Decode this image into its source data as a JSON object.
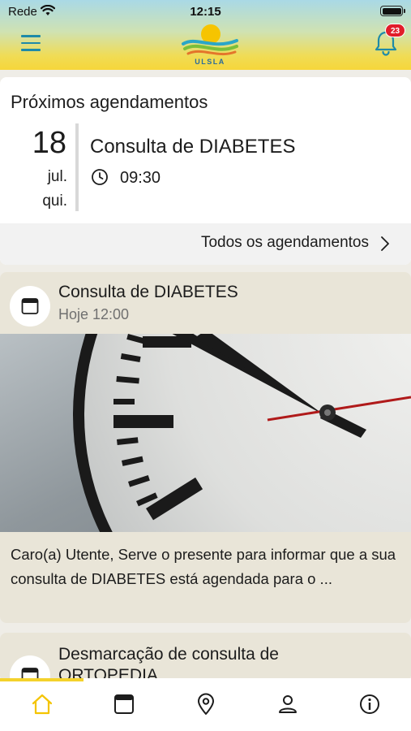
{
  "status_bar": {
    "carrier": "Rede",
    "time": "12:15"
  },
  "header": {
    "logo_text": "ULSLA",
    "notification_count": "23"
  },
  "upcoming": {
    "title": "Próximos agendamentos",
    "day": "18",
    "month": "jul.",
    "weekday": "qui.",
    "name": "Consulta de DIABETES",
    "time": "09:30",
    "all_link": "Todos os agendamentos"
  },
  "feed": [
    {
      "title": "Consulta de DIABETES",
      "subtitle": "Hoje 12:00",
      "body": "Caro(a) Utente, Serve o presente para informar que a sua consulta de DIABETES está agendada para o ..."
    },
    {
      "title_line1": "Desmarcação de consulta de",
      "title_line2": "ORTOPEDIA"
    }
  ],
  "tabs": [
    {
      "icon": "home-icon",
      "active": true
    },
    {
      "icon": "calendar-icon",
      "active": false
    },
    {
      "icon": "location-pin-icon",
      "active": false
    },
    {
      "icon": "person-icon",
      "active": false
    },
    {
      "icon": "info-icon",
      "active": false
    }
  ],
  "colors": {
    "accent_blue": "#1e8aa8",
    "accent_yellow": "#f4d22c",
    "badge_red": "#e11d2a",
    "feed_bg": "#e9e5d8"
  }
}
